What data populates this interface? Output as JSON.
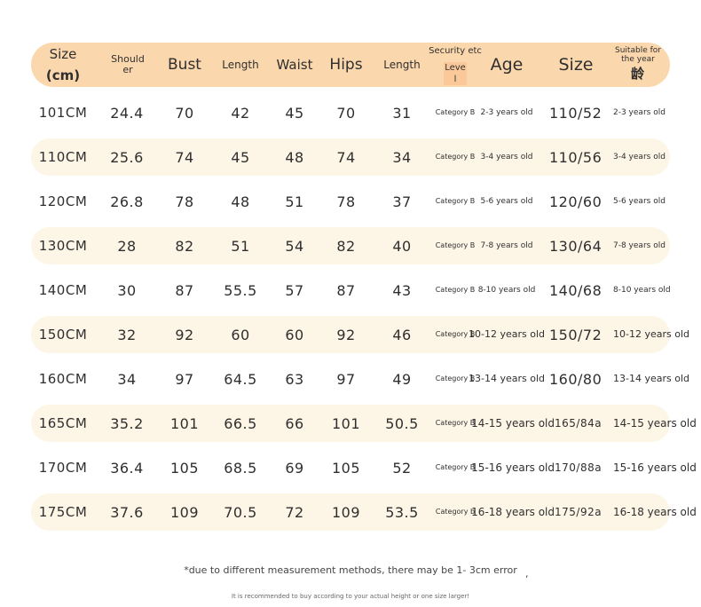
{
  "header": {
    "size_label": "Size",
    "size_unit": "(cm)",
    "shoulder": "Shoulder",
    "bust": "Bust",
    "length": "Length",
    "waist": "Waist",
    "hips": "Hips",
    "length2": "Length",
    "security_top": "Security etc",
    "security_level": "Level",
    "age": "Age",
    "size": "Size",
    "suitable": "Suitable for the year",
    "suitable_kanji": "龄"
  },
  "rows": [
    [
      "101CM",
      "24.4",
      "70",
      "42",
      "45",
      "70",
      "31",
      "Category B",
      "2-3 years old",
      "110/52",
      "2-3 years old"
    ],
    [
      "110CM",
      "25.6",
      "74",
      "45",
      "48",
      "74",
      "34",
      "Category B",
      "3-4 years old",
      "110/56",
      "3-4 years old"
    ],
    [
      "120CM",
      "26.8",
      "78",
      "48",
      "51",
      "78",
      "37",
      "Category B",
      "5-6 years old",
      "120/60",
      "5-6 years old"
    ],
    [
      "130CM",
      "28",
      "82",
      "51",
      "54",
      "82",
      "40",
      "Category B",
      "7-8 years old",
      "130/64",
      "7-8 years old"
    ],
    [
      "140CM",
      "30",
      "87",
      "55.5",
      "57",
      "87",
      "43",
      "Category B",
      "8-10 years old",
      "140/68",
      "8-10 years old"
    ],
    [
      "150CM",
      "32",
      "92",
      "60",
      "60",
      "92",
      "46",
      "Category B",
      "10-12 years old",
      "150/72",
      "10-12 years old"
    ],
    [
      "160CM",
      "34",
      "97",
      "64.5",
      "63",
      "97",
      "49",
      "Category B",
      "13-14 years old",
      "160/80",
      "13-14 years old"
    ],
    [
      "165CM",
      "35.2",
      "101",
      "66.5",
      "66",
      "101",
      "50.5",
      "Category B",
      "14-15 years old",
      "165/84a",
      "14-15 years old"
    ],
    [
      "170CM",
      "36.4",
      "105",
      "68.5",
      "69",
      "105",
      "52",
      "Category B",
      "15-16 years old",
      "170/88a",
      "15-16 years old"
    ],
    [
      "175CM",
      "37.6",
      "109",
      "70.5",
      "72",
      "109",
      "53.5",
      "Category b",
      "16-18 years old",
      "175/92a",
      "16-18 years old"
    ]
  ],
  "footnote": "*due to different measurement methods, there may be 1- 3cm error",
  "footnote_mark": ",",
  "small_note": "It is recommended to buy according to your actual height or one size larger!"
}
